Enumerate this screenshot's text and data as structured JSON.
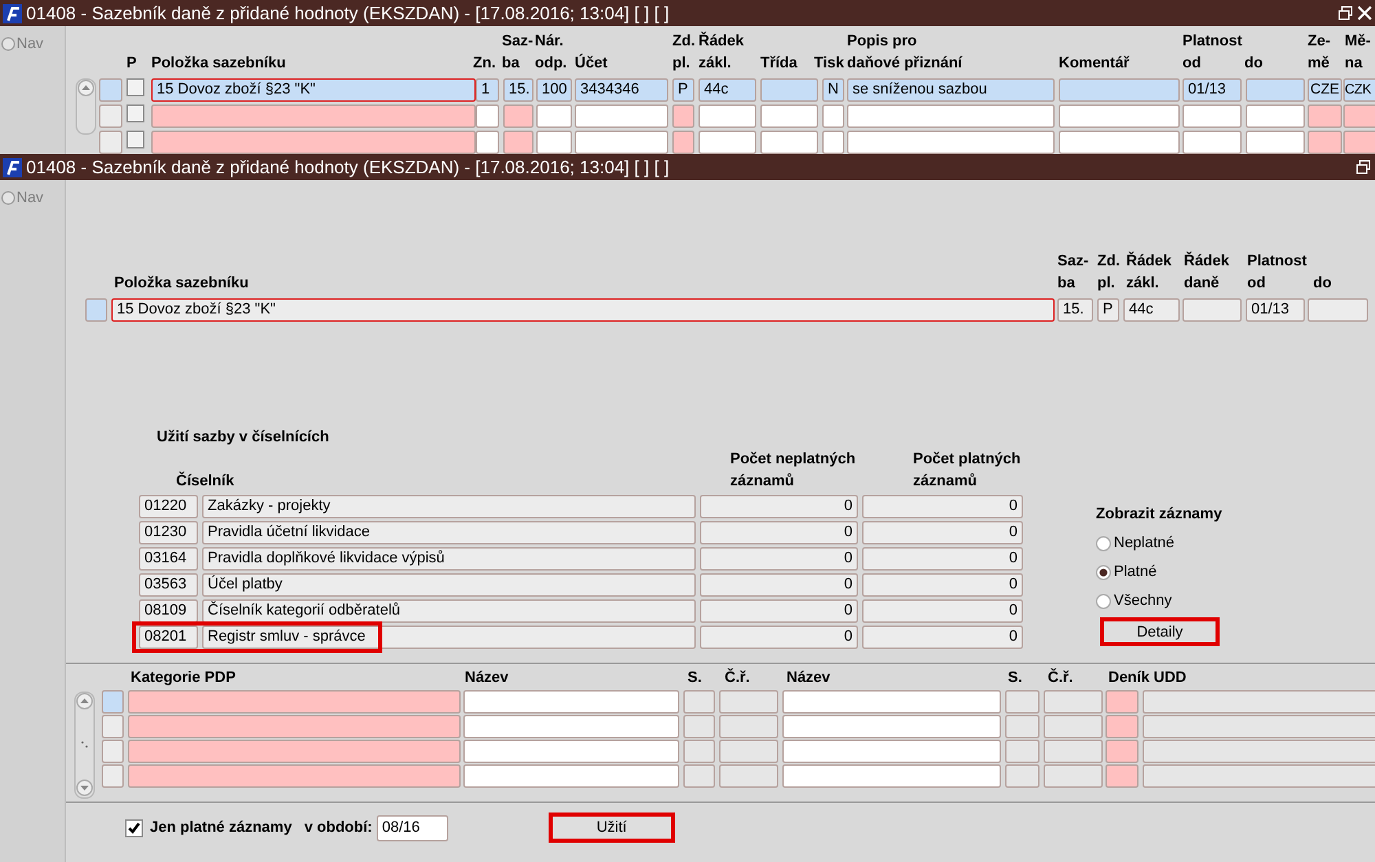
{
  "back_window": {
    "title": "01408 - Sazebník daně z přidané hodnoty (EKSZDAN) - [17.08.2016; 13:04]  [ ]  [ ]",
    "nav": {
      "label": "Nav",
      "disabled": true
    },
    "columns": [
      {
        "lines": [
          "P"
        ],
        "kind": "check"
      },
      {
        "lines": [
          "Položka sazebníku"
        ],
        "required": true
      },
      {
        "lines": [
          "Zn."
        ],
        "required": false
      },
      {
        "lines": [
          "Saz-",
          "ba"
        ],
        "required": true
      },
      {
        "lines": [
          "Nár.",
          "odp."
        ],
        "required": false
      },
      {
        "lines": [
          "Účet"
        ],
        "required": false
      },
      {
        "lines": [
          "Zd.",
          "pl."
        ],
        "required": true
      },
      {
        "lines": [
          "Řádek",
          "zákl."
        ],
        "required": false
      },
      {
        "lines": [
          "Třída"
        ],
        "required": false
      },
      {
        "lines": [
          "Tisk"
        ],
        "required": false
      },
      {
        "lines": [
          "Popis pro",
          "daňové přiznání"
        ],
        "required": false
      },
      {
        "lines": [
          "Komentář"
        ],
        "required": false
      },
      {
        "lines": [
          "Platnost",
          "od"
        ],
        "required": false
      },
      {
        "lines": [
          "do"
        ],
        "required": false
      },
      {
        "lines": [
          "Ze-",
          "mě"
        ],
        "required": true
      },
      {
        "lines": [
          "Mě-",
          "na"
        ],
        "required": true
      }
    ],
    "rows": [
      {
        "current": true,
        "checked": false,
        "cells": [
          "15  Dovoz zboží §23 \"K\"",
          "1",
          "15.",
          "100",
          "3434346",
          "P",
          "44c",
          null,
          "N",
          "se sníženou sazbou",
          null,
          "01/13",
          null,
          "CZE",
          "CZK"
        ]
      },
      {
        "current": false,
        "checked": false
      },
      {
        "current": false,
        "checked": false
      }
    ]
  },
  "front_window": {
    "title": "01408 - Sazebník daně z přidané hodnoty (EKSZDAN) - [17.08.2016; 13:04]  [ ]  [ ]",
    "nav": {
      "label": "Nav",
      "disabled": true
    },
    "item": {
      "columns": [
        {
          "lines": [
            "Položka sazebníku"
          ]
        },
        {
          "lines": [
            "Saz-",
            "ba"
          ]
        },
        {
          "lines": [
            "Zd.",
            "pl."
          ]
        },
        {
          "lines": [
            "Řádek",
            "zákl."
          ]
        },
        {
          "lines": [
            "Řádek",
            "daně"
          ]
        },
        {
          "lines": [
            "Platnost",
            "od"
          ]
        },
        {
          "lines": [
            "do"
          ]
        }
      ],
      "row": {
        "current": true,
        "cells": [
          "15  Dovoz zboží §23 \"K\"",
          "15.",
          "P",
          "44c",
          null,
          "01/13",
          null
        ]
      }
    },
    "usage": {
      "title": "Užití sazby v číselnících",
      "columns": [
        {
          "lines": [
            "Číselník"
          ]
        },
        {
          "lines": [
            "Počet neplatných",
            "záznamů"
          ]
        },
        {
          "lines": [
            "Počet platných",
            "záznamů"
          ]
        }
      ],
      "rows": [
        {
          "code": "01220",
          "name": "Zakázky - projekty",
          "invalid_count": "0",
          "valid_count": "0",
          "highlighted": false
        },
        {
          "code": "01230",
          "name": "Pravidla účetní likvidace",
          "invalid_count": "0",
          "valid_count": "0",
          "highlighted": false
        },
        {
          "code": "03164",
          "name": "Pravidla doplňkové likvidace výpisů",
          "invalid_count": "0",
          "valid_count": "0",
          "highlighted": false
        },
        {
          "code": "03563",
          "name": "Účel platby",
          "invalid_count": "0",
          "valid_count": "0",
          "highlighted": false
        },
        {
          "code": "08109",
          "name": "Číselník kategorií odběratelů",
          "invalid_count": "0",
          "valid_count": "0",
          "highlighted": false
        },
        {
          "code": "08201",
          "name": "Registr smluv - správce",
          "invalid_count": "0",
          "valid_count": "0",
          "highlighted": true
        }
      ]
    },
    "filter": {
      "title": "Zobrazit záznamy",
      "options": [
        {
          "label": "Neplatné",
          "selected": false
        },
        {
          "label": "Platné",
          "selected": true
        },
        {
          "label": "Všechny",
          "selected": false
        }
      ],
      "button": {
        "label": "Detaily",
        "highlighted": true
      }
    },
    "pdp": {
      "columns": [
        {
          "label": "Kategorie PDP",
          "kind": "required"
        },
        {
          "label": "Název",
          "kind": "input"
        },
        {
          "label": "S.",
          "kind": "readonly"
        },
        {
          "label": "Č.ř.",
          "kind": "readonly"
        },
        {
          "label": "Název",
          "kind": "input"
        },
        {
          "label": "S.",
          "kind": "readonly"
        },
        {
          "label": "Č.ř.",
          "kind": "readonly"
        },
        {
          "label": "Deník UDD",
          "kind": "required"
        },
        {
          "kind": "readonly"
        }
      ],
      "rows": [
        {
          "current": true
        },
        {
          "current": false
        },
        {
          "current": false
        },
        {
          "current": false
        }
      ]
    },
    "footer": {
      "checkbox": {
        "label": "Jen platné záznamy",
        "checked": true
      },
      "period_label": "v období:",
      "period": "08/16",
      "button": {
        "label": "Užití",
        "highlighted": true
      }
    }
  }
}
